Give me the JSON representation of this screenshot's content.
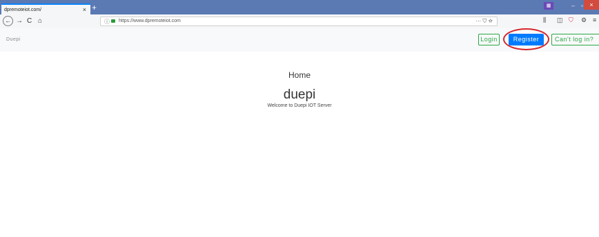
{
  "browser": {
    "tab_title": "dpremoteiot.com/",
    "tab_close": "×",
    "new_tab": "+",
    "url": "https://www.dpremoteiot.com",
    "url_actions": "··· ⛉ ☆",
    "ext_badge": "▦",
    "toolbar": {
      "library": "⫼",
      "sidebar": "◫",
      "pocket": "⛉",
      "extension": "⚙",
      "menu": "≡"
    },
    "window_controls": {
      "minimize": "–",
      "restore": "▫",
      "close": "×"
    },
    "nav": {
      "back": "←",
      "forward": "→",
      "reload": "C",
      "home": "⌂"
    }
  },
  "site": {
    "brand": "Duepi",
    "login_label": "Login",
    "register_label": "Register",
    "cant_login_label": "Can't log in?",
    "page_title": "Home",
    "site_name": "duepi",
    "welcome": "Welcome to Duepi IOT Server"
  },
  "colors": {
    "register": "#007bff",
    "success": "#28a745",
    "highlight": "#d5252a"
  }
}
